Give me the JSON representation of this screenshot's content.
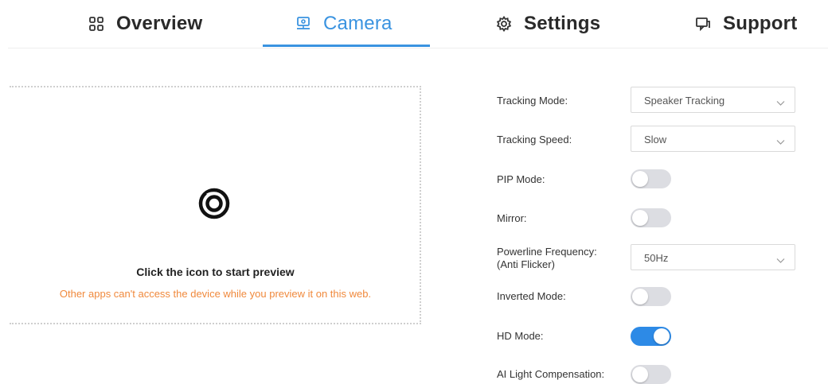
{
  "tabs": [
    {
      "label": "Overview",
      "icon": "grid-icon",
      "active": false
    },
    {
      "label": "Camera",
      "icon": "camera-icon",
      "active": true
    },
    {
      "label": "Settings",
      "icon": "gear-icon",
      "active": false
    },
    {
      "label": "Support",
      "icon": "chat-icon",
      "active": false
    }
  ],
  "preview": {
    "icon": "camera-lens-icon",
    "title": "Click the icon to start preview",
    "note": "Other apps can't access the device while you preview it on this web."
  },
  "settings": {
    "tracking_mode": {
      "label": "Tracking Mode:",
      "value": "Speaker Tracking"
    },
    "tracking_speed": {
      "label": "Tracking Speed:",
      "value": "Slow"
    },
    "pip_mode": {
      "label": "PIP Mode:",
      "on": false
    },
    "mirror": {
      "label": "Mirror:",
      "on": false
    },
    "powerline_frequency": {
      "label_line1": "Powerline Frequency:",
      "label_line2": "(Anti Flicker)",
      "value": "50Hz"
    },
    "inverted_mode": {
      "label": "Inverted Mode:",
      "on": false
    },
    "hd_mode": {
      "label": "HD Mode:",
      "on": true
    },
    "ai_light_compensation": {
      "label": "AI Light Compensation:",
      "on": false
    }
  },
  "colors": {
    "accent": "#3a93e0",
    "toggle_on": "#2d8ae6",
    "toggle_off": "#dcdde2",
    "warning_text": "#f0893c"
  }
}
